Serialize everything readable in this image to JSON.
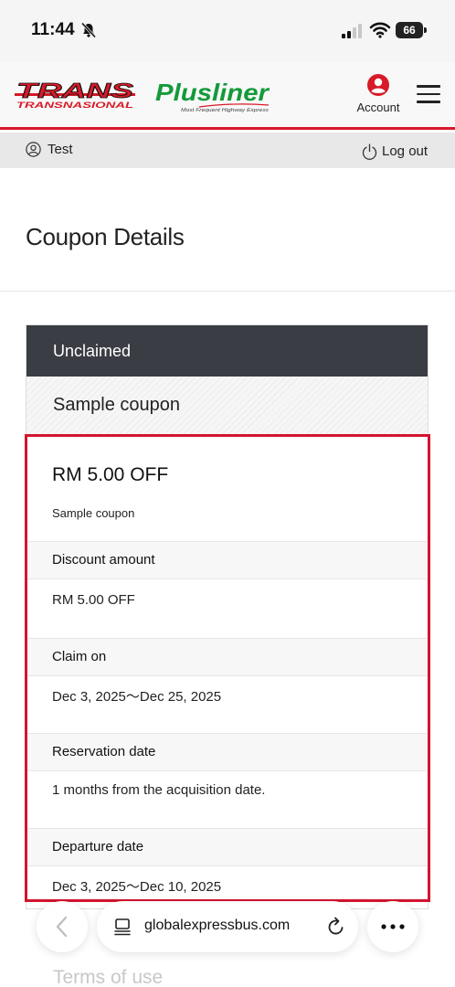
{
  "status_bar": {
    "time": "11:44",
    "battery": "66"
  },
  "header": {
    "logo_trans": "TRANS",
    "logo_trans_sub": "TRANSNASIONAL",
    "logo_plus": "Plusliner",
    "logo_plus_tagline": "Most Frequent Highway Express",
    "account_label": "Account"
  },
  "user_bar": {
    "user_name": "Test",
    "logout_label": "Log out"
  },
  "page": {
    "title": "Coupon Details"
  },
  "coupon": {
    "status": "Unclaimed",
    "name": "Sample coupon",
    "offer": "RM 5.00 OFF",
    "description": "Sample coupon",
    "sections": [
      {
        "label": "Discount amount",
        "value": "RM 5.00 OFF"
      },
      {
        "label": "Claim on",
        "value": "Dec 3, 2025～Dec 25, 2025"
      },
      {
        "label": "Reservation date",
        "value": "1 months from the acquisition date."
      },
      {
        "label": "Departure date",
        "value": "Dec 3, 2025～Dec 10, 2025"
      }
    ]
  },
  "browser": {
    "url": "globalexpressbus.com"
  },
  "footer": {
    "terms_label": "Terms of use"
  },
  "colors": {
    "brand_red": "#d71a28",
    "plus_green": "#149a3a",
    "status_dark": "#3a3d43"
  }
}
